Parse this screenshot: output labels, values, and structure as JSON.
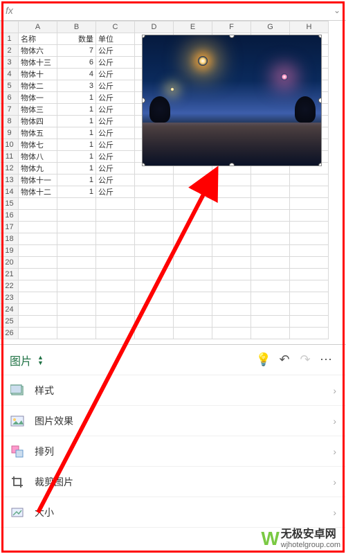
{
  "formula_bar": {
    "fx_label": "fx",
    "value": ""
  },
  "columns": [
    "A",
    "B",
    "C",
    "D",
    "E",
    "F",
    "G",
    "H"
  ],
  "rows": [
    1,
    2,
    3,
    4,
    5,
    6,
    7,
    8,
    9,
    10,
    11,
    12,
    13,
    14,
    15,
    16,
    17,
    18,
    19,
    20,
    21,
    22,
    23,
    24,
    25,
    26
  ],
  "data": {
    "1": {
      "A": "名称",
      "B": "数量",
      "C": "单位"
    },
    "2": {
      "A": "物体六",
      "B": "7",
      "C": "公斤"
    },
    "3": {
      "A": "物体十三",
      "B": "6",
      "C": "公斤"
    },
    "4": {
      "A": "物体十",
      "B": "4",
      "C": "公斤"
    },
    "5": {
      "A": "物体二",
      "B": "3",
      "C": "公斤"
    },
    "6": {
      "A": "物体一",
      "B": "1",
      "C": "公斤"
    },
    "7": {
      "A": "物体三",
      "B": "1",
      "C": "公斤"
    },
    "8": {
      "A": "物体四",
      "B": "1",
      "C": "公斤"
    },
    "9": {
      "A": "物体五",
      "B": "1",
      "C": "公斤"
    },
    "10": {
      "A": "物体七",
      "B": "1",
      "C": "公斤"
    },
    "11": {
      "A": "物体八",
      "B": "1",
      "C": "公斤"
    },
    "12": {
      "A": "物体九",
      "B": "1",
      "C": "公斤"
    },
    "13": {
      "A": "物体十一",
      "B": "1",
      "C": "公斤"
    },
    "14": {
      "A": "物体十二",
      "B": "1",
      "C": "公斤"
    }
  },
  "panel": {
    "title": "图片",
    "items": [
      {
        "label": "样式",
        "icon": "styles-icon"
      },
      {
        "label": "图片效果",
        "icon": "effects-icon"
      },
      {
        "label": "排列",
        "icon": "arrange-icon"
      },
      {
        "label": "裁剪图片",
        "icon": "crop-icon"
      },
      {
        "label": "大小",
        "icon": "size-icon"
      }
    ]
  },
  "watermark": {
    "logo": "W",
    "title": "无极安卓网",
    "url": "wjhotelgroup.com"
  }
}
